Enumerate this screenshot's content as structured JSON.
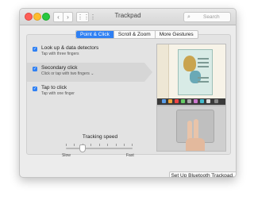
{
  "window": {
    "title": "Trackpad"
  },
  "toolbar": {
    "back": "‹",
    "forward": "›",
    "grid": "⋮⋮⋮",
    "search_placeholder": "Search",
    "search_icon": "search-icon"
  },
  "tabs": [
    {
      "label": "Point & Click",
      "active": true
    },
    {
      "label": "Scroll & Zoom",
      "active": false
    },
    {
      "label": "More Gestures",
      "active": false
    }
  ],
  "options": [
    {
      "label": "Look up & data detectors",
      "sub": "Tap with three fingers",
      "checked": true,
      "selected": false
    },
    {
      "label": "Secondary click",
      "sub": "Click or tap with two fingers  ⌄",
      "checked": true,
      "selected": true
    },
    {
      "label": "Tap to click",
      "sub": "Tap with one finger",
      "checked": true,
      "selected": false
    }
  ],
  "tracking": {
    "label": "Tracking speed",
    "slow": "Slow",
    "fast": "Fast",
    "value_fraction": 0.25
  },
  "footer": {
    "bluetooth_button": "Set Up Bluetooth Trackpad...",
    "help": "?"
  },
  "colors": {
    "accent": "#2f80f3"
  }
}
